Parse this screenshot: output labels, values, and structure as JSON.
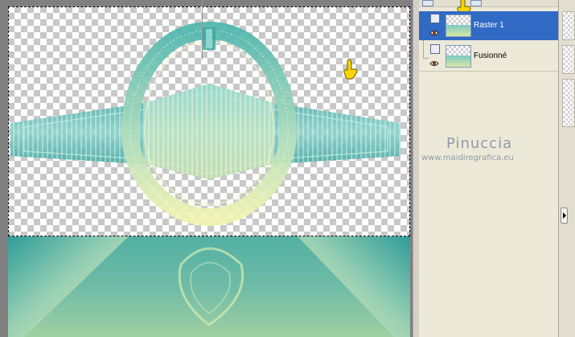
{
  "layers_panel": {
    "layers": [
      {
        "name": "Raster 1",
        "selected": true,
        "visible": true
      },
      {
        "name": "Fusionné",
        "selected": false,
        "visible": true
      }
    ],
    "icons": [
      "layers-toolbar-icon",
      "eye-icon",
      "layer-type-icon",
      "pointing-hand-icon"
    ]
  },
  "watermark": {
    "name": "Pinuccia",
    "url": "www.maidiregrafica.eu"
  },
  "colors": {
    "selection": "#316ac5",
    "panel_bg": "#ece9d8",
    "teal": "#2ea5a0",
    "pale_yellow": "#eef2a8",
    "hand": "#f5d400"
  }
}
